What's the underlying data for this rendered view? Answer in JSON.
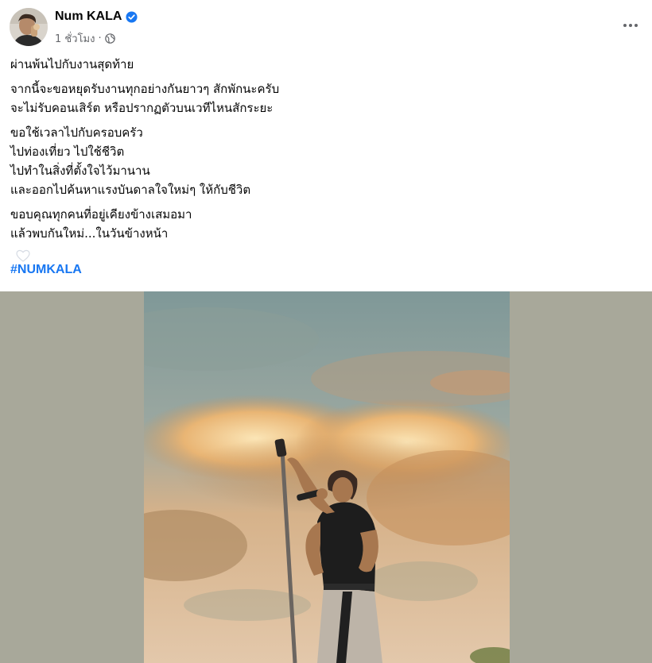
{
  "post": {
    "author_name": "Num KALA",
    "time": "1 ชั่วโมง",
    "separator": "·",
    "paragraphs": [
      [
        "ผ่านพ้นไปกับงานสุดท้าย"
      ],
      [
        "จากนี้จะขอหยุดรับงานทุกอย่างกันยาวๆ สักพักนะครับ",
        "จะไม่รับคอนเสิร์ต หรือปรากฏตัวบนเวทีไหนสักระยะ"
      ],
      [
        "ขอใช้เวลาไปกับครอบครัว",
        "ไปท่องเที่ยว ไปใช้ชีวิต",
        "ไปทำในสิ่งที่ตั้งใจไว้มานาน",
        "และออกไปค้นหาแรงบันดาลใจใหม่ๆ ให้กับชีวิต"
      ],
      [
        "ขอบคุณทุกคนที่อยู่เคียงข้างเสมอมา",
        "แล้วพบกันใหม่...ในวันข้างหน้า"
      ]
    ],
    "hashtag": "#NUMKALA"
  },
  "icons": {
    "verified": "verified-badge-icon",
    "audience": "globe-icon",
    "more": "more-options-icon",
    "emoji": "white-heart-icon"
  },
  "colors": {
    "accent": "#1877f2",
    "secondary_text": "#65676b",
    "media_background": "#a8a89a"
  }
}
